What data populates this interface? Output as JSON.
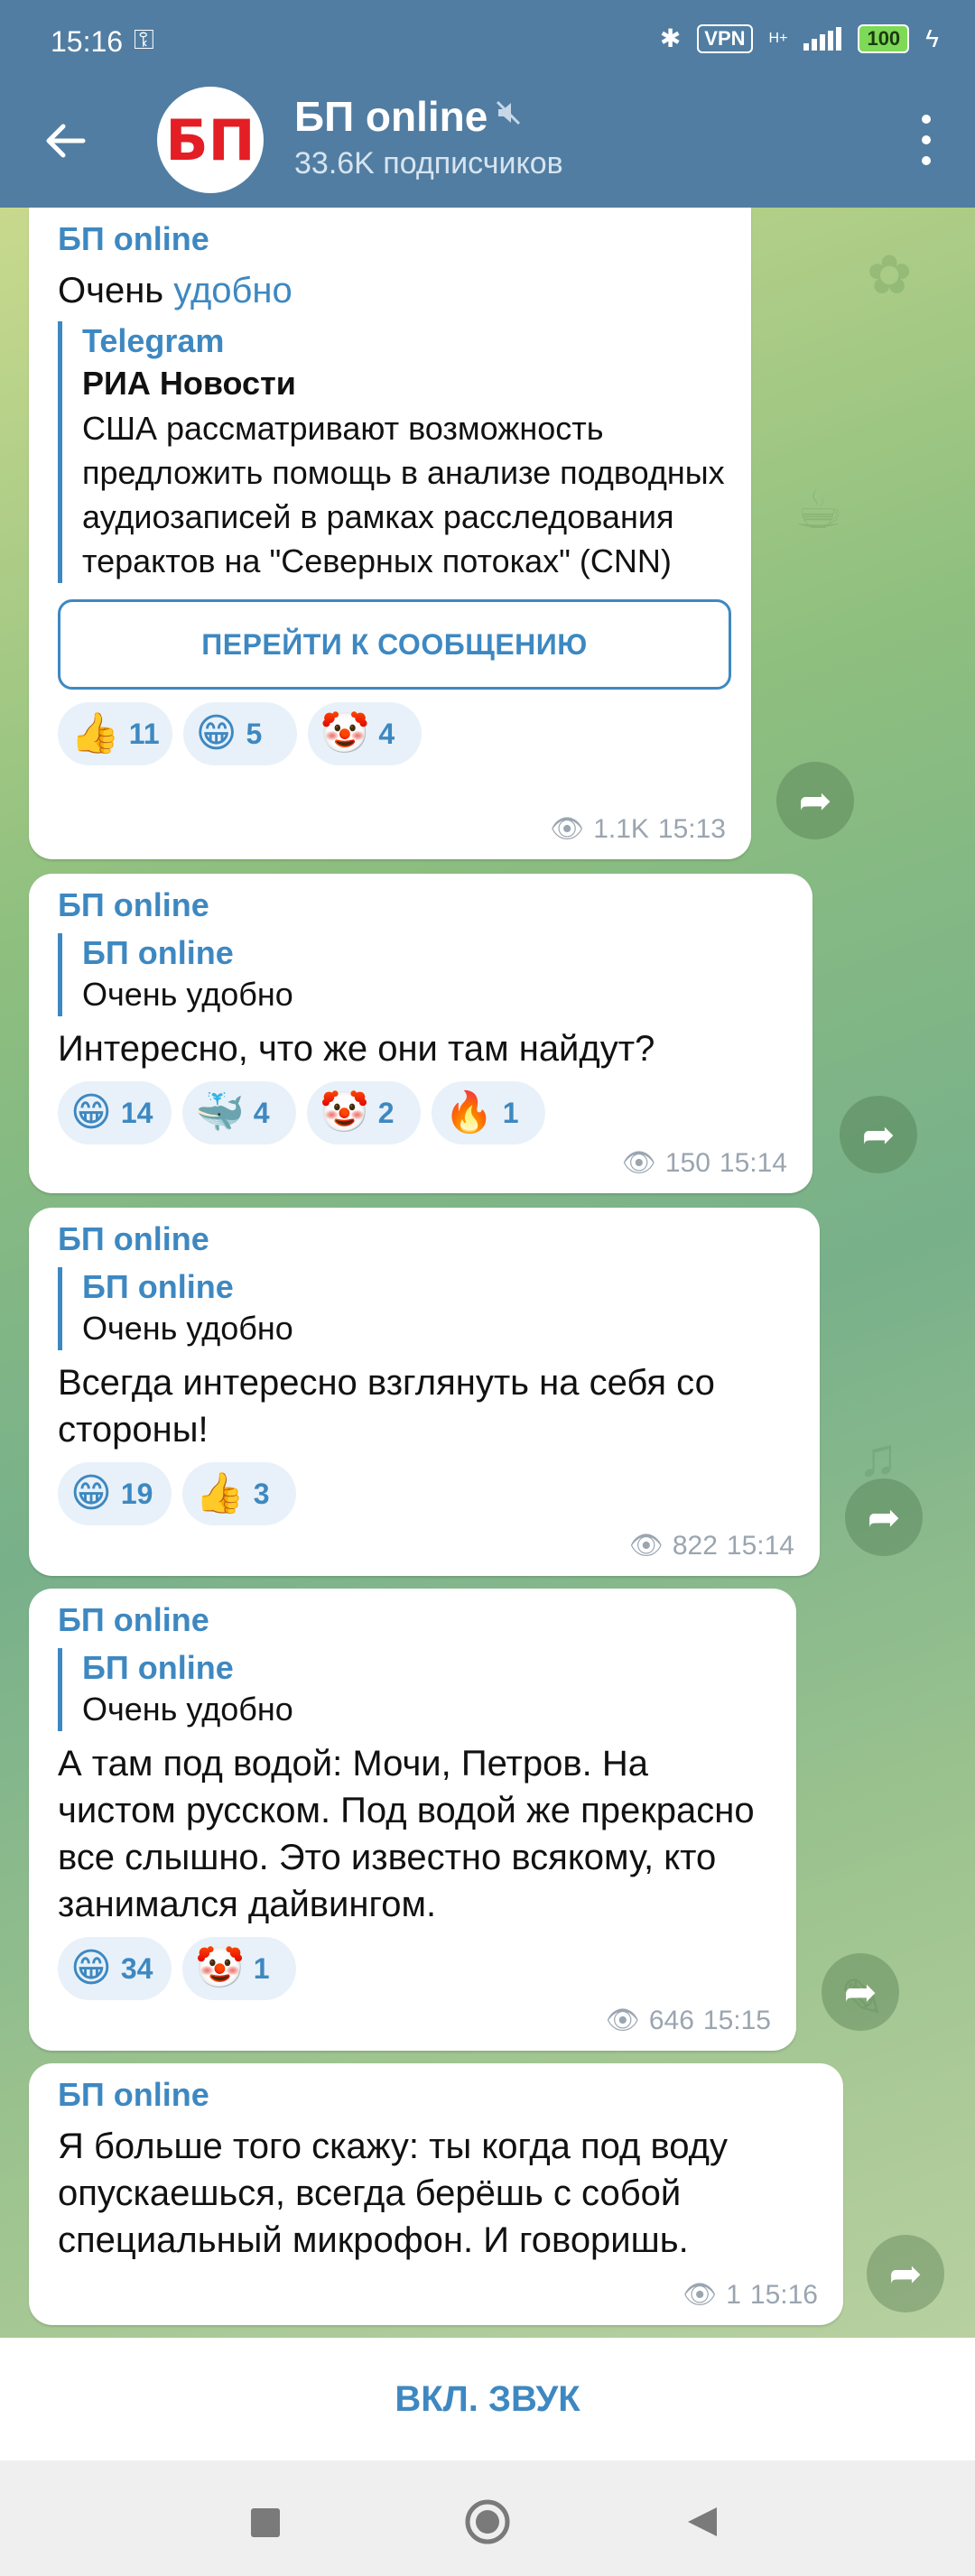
{
  "status_bar": {
    "time": "15:16",
    "vpn": "VPN",
    "network": "H+",
    "battery": "100"
  },
  "header": {
    "avatar_text": "БП",
    "title": "БП online",
    "subscribers": "33.6K подписчиков"
  },
  "messages": [
    {
      "sender": "БП online",
      "text_plain": "Очень",
      "text_link": "удобно",
      "quote": {
        "source": "Telegram",
        "author": "РИА Новости",
        "body": "США рассматривают возможность предложить помощь в анализе подводных аудиозаписей в рамках расследования терактов на \"Северных потоках\" (CNN)"
      },
      "button": "ПЕРЕЙТИ К СООБЩЕНИЮ",
      "reactions": [
        {
          "emoji": "👍",
          "count": "11"
        },
        {
          "emoji": "😁",
          "count": "5"
        },
        {
          "emoji": "🤡",
          "count": "4"
        }
      ],
      "views": "1.1K",
      "time": "15:13"
    },
    {
      "sender": "БП online",
      "reply_author": "БП online",
      "reply_text": "Очень удобно",
      "text": "Интересно, что же они там найдут?",
      "reactions": [
        {
          "emoji": "😁",
          "count": "14"
        },
        {
          "emoji": "🐳",
          "count": "4"
        },
        {
          "emoji": "🤡",
          "count": "2"
        },
        {
          "emoji": "🔥",
          "count": "1"
        }
      ],
      "views": "150",
      "time": "15:14"
    },
    {
      "sender": "БП online",
      "reply_author": "БП online",
      "reply_text": "Очень удобно",
      "text": "Всегда интересно взглянуть на себя со стороны!",
      "reactions": [
        {
          "emoji": "😁",
          "count": "19"
        },
        {
          "emoji": "👍",
          "count": "3"
        }
      ],
      "views": "822",
      "time": "15:14"
    },
    {
      "sender": "БП online",
      "reply_author": "БП online",
      "reply_text": "Очень удобно",
      "text": "А там под водой: Мочи, Петров. На чистом русском. Под водой же прекрасно все слышно. Это известно всякому, кто занимался дайвингом.",
      "reactions": [
        {
          "emoji": "😁",
          "count": "34"
        },
        {
          "emoji": "🤡",
          "count": "1"
        }
      ],
      "views": "646",
      "time": "15:15"
    },
    {
      "sender": "БП online",
      "text": "Я больше того скажу: ты когда под воду опускаешься, всегда берёшь с собой специальный микрофон. И говоришь.",
      "views": "1",
      "time": "15:16"
    }
  ],
  "bottom": {
    "unmute_label": "ВКЛ. ЗВУК"
  },
  "colors": {
    "header": "#517da2",
    "accent": "#3e88c1"
  }
}
